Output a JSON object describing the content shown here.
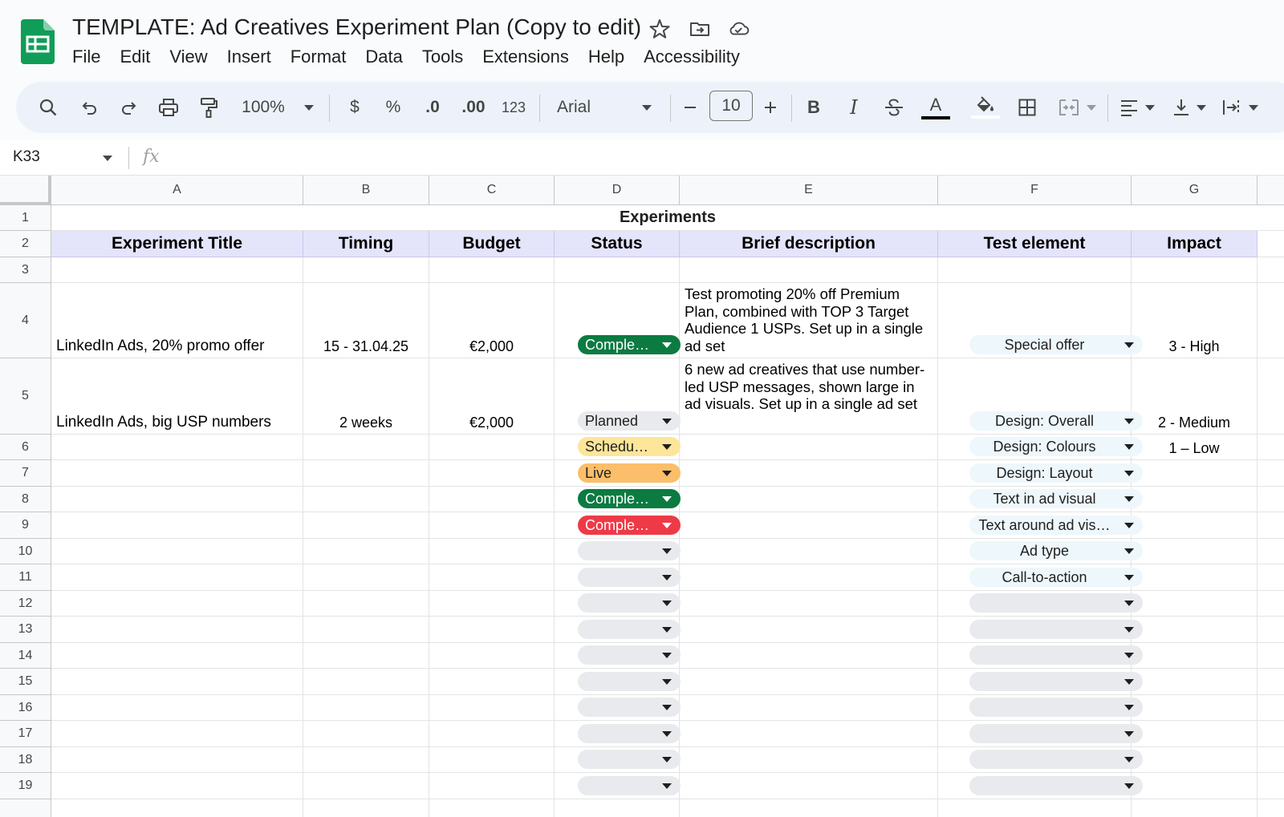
{
  "app": {
    "doc_title": "TEMPLATE: Ad Creatives Experiment Plan (Copy to edit)",
    "menu": [
      "File",
      "Edit",
      "View",
      "Insert",
      "Format",
      "Data",
      "Tools",
      "Extensions",
      "Help",
      "Accessibility"
    ]
  },
  "toolbar": {
    "zoom": "100%",
    "currency": "$",
    "percent": "%",
    "decrease_decimal": ".0",
    "increase_decimal": ".00",
    "number_format": "123",
    "font": "Arial",
    "font_size": "10",
    "bold": "B",
    "italic": "I",
    "text_color_glyph": "A"
  },
  "formula_bar": {
    "name_box": "K33",
    "fx": "fx",
    "value": ""
  },
  "columns": [
    "A",
    "B",
    "C",
    "D",
    "E",
    "F",
    "G"
  ],
  "rows": [
    "1",
    "2",
    "3",
    "4",
    "5",
    "6",
    "7",
    "8",
    "9",
    "10",
    "11",
    "12",
    "13",
    "14",
    "15",
    "16",
    "17",
    "18",
    "19"
  ],
  "sheet": {
    "title": "Experiments",
    "headers": [
      "Experiment Title",
      "Timing",
      "Budget",
      "Status",
      "Brief description",
      "Test element",
      "Impact"
    ],
    "entries": [
      {
        "title": "LinkedIn Ads, 20% promo offer",
        "timing": "15 - 31.04.25",
        "budget": "€2,000",
        "description": "Test promoting 20% off Premium Plan, combined with TOP 3 Target Audience 1 USPs. Set up in a single ad set"
      },
      {
        "title": "LinkedIn Ads, big USP numbers",
        "timing": "2 weeks",
        "budget": "€2,000",
        "description": "6 new ad creatives that use number-led USP messages, shown large in ad visuals. Set up in a single ad set"
      }
    ],
    "status_chips": [
      {
        "label": "Comple…",
        "bg": "#0b7b42",
        "fg": "#ffffff"
      },
      {
        "label": "Planned",
        "bg": "#e8eaed",
        "fg": "#1f1f1f"
      },
      {
        "label": "Schedu…",
        "bg": "#fde59a",
        "fg": "#1f1f1f"
      },
      {
        "label": "Live",
        "bg": "#fbbe6a",
        "fg": "#1f1f1f"
      },
      {
        "label": "Comple…",
        "bg": "#0b7b42",
        "fg": "#ffffff"
      },
      {
        "label": "Comple…",
        "bg": "#ee3a47",
        "fg": "#ffffff"
      }
    ],
    "test_elements": [
      "Special offer",
      "Design: Overall",
      "Design: Colours",
      "Design: Layout",
      "Text in ad visual",
      "Text around ad vis…",
      "Ad type",
      "Call-to-action"
    ],
    "impacts": [
      "3 - High",
      "2 - Medium",
      "1 – Low"
    ]
  }
}
